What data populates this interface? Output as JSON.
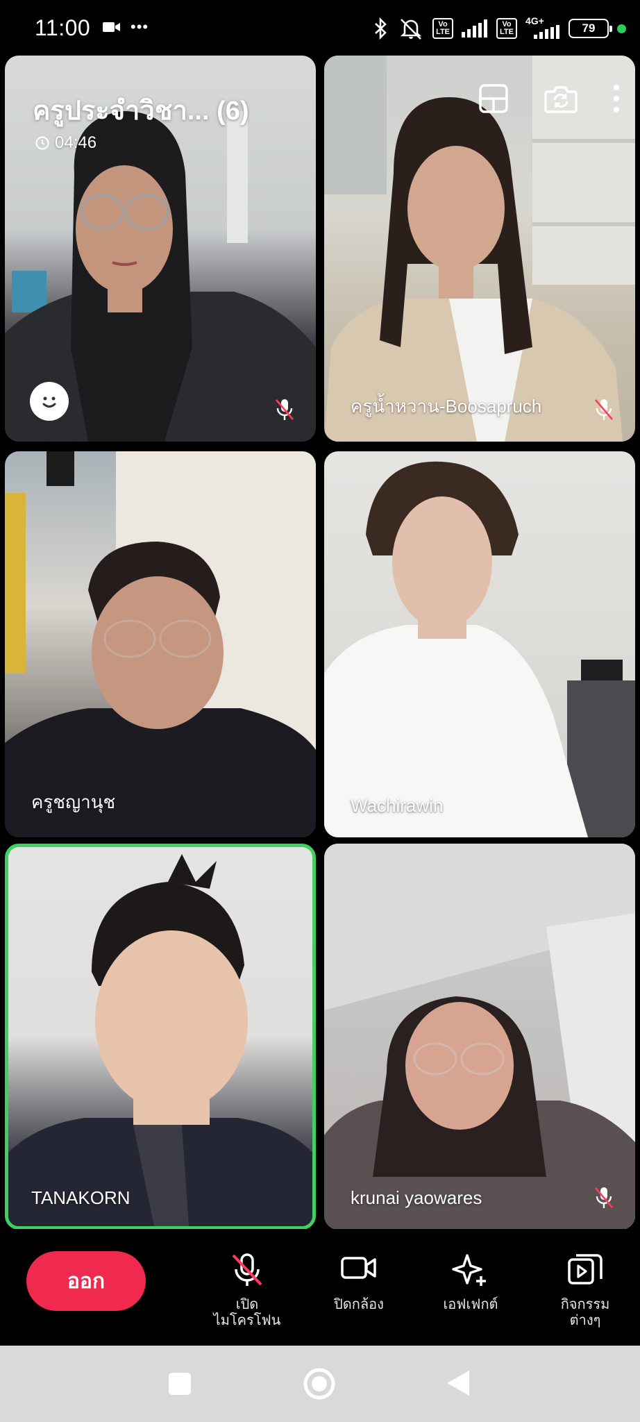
{
  "status_bar": {
    "time": "11:00",
    "dots": "•••",
    "volte_1": "Vo\nLTE",
    "volte_2": "Vo\nLTE",
    "network": "4G+",
    "battery": "79"
  },
  "meeting": {
    "title": "ครูประจำวิชา... (6)",
    "timer": "04:46"
  },
  "participants": [
    {
      "name": "",
      "muted": true,
      "is_self": true
    },
    {
      "name": "ครูน้ำหวาน-Boosapruch",
      "muted": true
    },
    {
      "name": "ครูชญานุช",
      "muted": false
    },
    {
      "name": "Wachirawin",
      "muted": false
    },
    {
      "name": "TANAKORN",
      "muted": false,
      "active_speaker": true
    },
    {
      "name": "krunai yaowares",
      "muted": true
    }
  ],
  "controls": {
    "leave_label": "ออก",
    "mic_label": "เปิด\nไมโครโฟน",
    "camera_label": "ปิดกล้อง",
    "effects_label": "เอฟเฟกต์",
    "activities_label": "กิจกรรม\nต่างๆ"
  },
  "colors": {
    "leave": "#f0294e",
    "active_speaker_border": "#3fd060",
    "mute_slash": "#ff3b5c"
  }
}
